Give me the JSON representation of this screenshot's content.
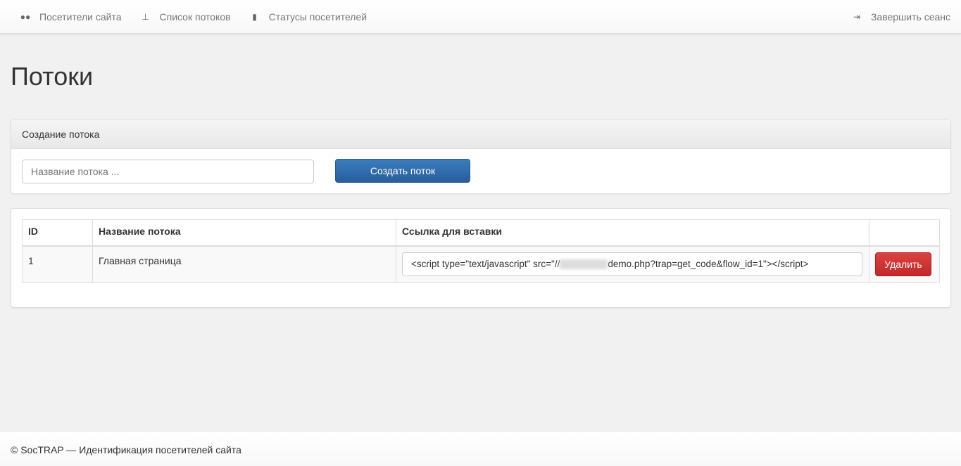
{
  "nav": {
    "items": [
      {
        "label": "Посетители сайта",
        "icon": "users-icon"
      },
      {
        "label": "Список потоков",
        "icon": "sitemap-icon"
      },
      {
        "label": "Статусы посетителей",
        "icon": "bookmark-icon"
      }
    ],
    "logout": "Завершить сеанс"
  },
  "page_title": "Потоки",
  "create": {
    "heading": "Создание потока",
    "placeholder": "Название потока ...",
    "button": "Создать поток"
  },
  "table": {
    "headers": [
      "ID",
      "Название потока",
      "Ссылка для вставки",
      ""
    ],
    "rows": [
      {
        "id": "1",
        "name": "Главная страница",
        "code_prefix": "<script type=\"text/javascript\" src=\"//",
        "code_suffix": "demo.php?trap=get_code&flow_id=1\"></script>",
        "delete": "Удалить"
      }
    ]
  },
  "footer": "© SocTRAP — Идентификация посетителей сайта"
}
